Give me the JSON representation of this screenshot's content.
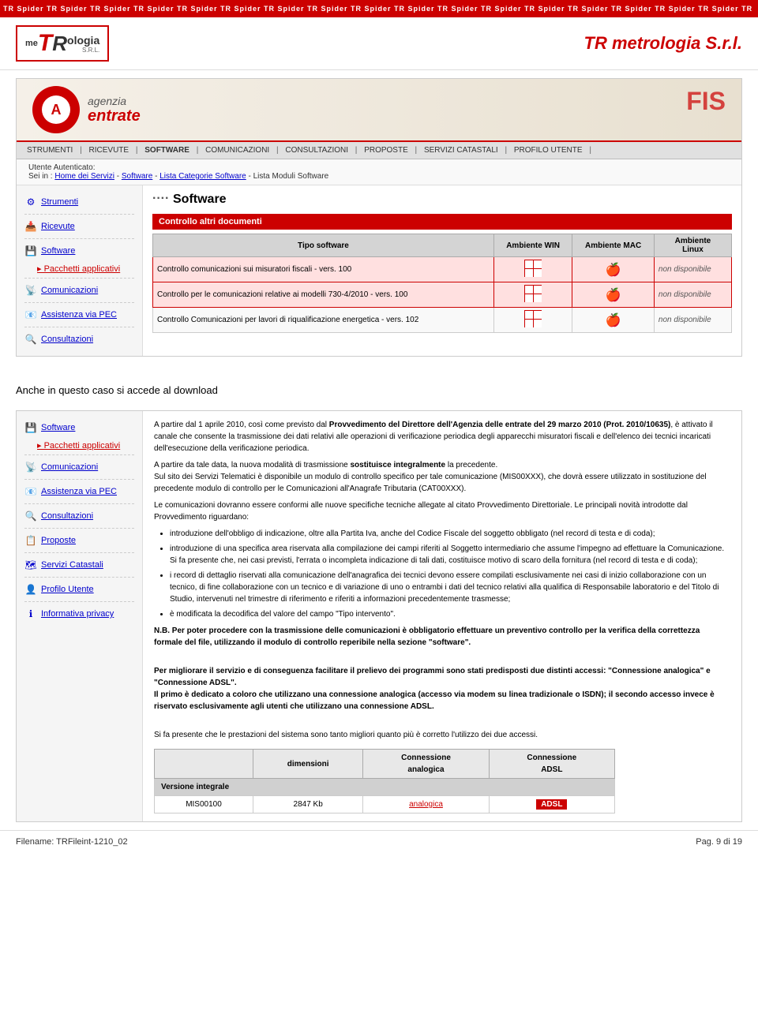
{
  "topBanner": {
    "text": "TR Spider  TR Spider  TR Spider  TR Spider  TR Spider  TR Spider  TR Spider  TR Spider  TR Spider  TR Spider  TR Spider  TR Spider  TR Spider  TR Spider  TR Spider  TR Spider  TR Spider  TR"
  },
  "header": {
    "logoPrefix": "me",
    "logoR": "R",
    "logoSuffix": "ologia",
    "logoSRL": "S.R.L.",
    "title": "TR metrologia S.r.l."
  },
  "agencyBanner": {
    "name1": "agenzia",
    "name2": "entrate",
    "rightText": "FIS"
  },
  "navBar": {
    "items": [
      "STRUMENTI",
      "RICEVUTE",
      "SOFTWARE",
      "COMUNICAZIONI",
      "CONSULTAZIONI",
      "PROPOSTE",
      "SERVIZI CATASTALI",
      "PROFILO UTENTE"
    ]
  },
  "breadcrumb": {
    "label": "Utente Autenticato:",
    "path": "Sei in : Home dei Servizi - Software - Lista Categorie Software - Lista Moduli Software"
  },
  "sidebar": {
    "items": [
      {
        "icon": "⚙",
        "label": "Strumenti"
      },
      {
        "icon": "📥",
        "label": "Ricevute"
      },
      {
        "icon": "💾",
        "label": "Software"
      },
      {
        "icon": "→",
        "label": "Pacchetti applicativi",
        "sub": true
      },
      {
        "icon": "📡",
        "label": "Comunicazioni"
      },
      {
        "icon": "📧",
        "label": "Assistenza via PEC"
      },
      {
        "icon": "🔍",
        "label": "Consultazioni"
      }
    ]
  },
  "mainPanel": {
    "title": "Software",
    "sectionHeader": "Controllo altri documenti",
    "tableHeaders": [
      "Tipo software",
      "Ambiente WIN",
      "Ambiente MAC",
      "Ambiente Linux"
    ],
    "tableRows": [
      {
        "tipo": "Controllo comunicazioni sui misuratori fiscali - vers. 100",
        "win": "win-icon",
        "mac": "mac-icon",
        "linux": "non disponibile",
        "highlighted": true
      },
      {
        "tipo": "Controllo per le comunicazioni relative ai modelli 730-4/2010 - vers. 100",
        "win": "win-icon",
        "mac": "mac-icon",
        "linux": "non disponibile",
        "highlighted": true
      },
      {
        "tipo": "Controllo Comunicazioni per lavori di riqualificazione energetica - vers. 102",
        "win": "win-icon",
        "mac": "mac-icon",
        "linux": "non disponibile",
        "highlighted": false
      }
    ]
  },
  "annotationText": "Anche in questo caso si accede al download",
  "bottomSidebar": {
    "items": [
      {
        "icon": "💾",
        "label": "Software"
      },
      {
        "icon": "→",
        "label": "Pacchetti applicativi",
        "sub": true
      },
      {
        "icon": "📡",
        "label": "Comunicazioni"
      },
      {
        "icon": "📧",
        "label": "Assistenza via PEC"
      },
      {
        "icon": "🔍",
        "label": "Consultazioni"
      },
      {
        "icon": "📋",
        "label": "Proposte"
      },
      {
        "icon": "🗺",
        "label": "Servizi Catastali"
      },
      {
        "icon": "👤",
        "label": "Profilo Utente"
      },
      {
        "icon": "ℹ",
        "label": "Informativa privacy"
      }
    ]
  },
  "bottomMain": {
    "paragraph1": "A partire dal 1 aprile 2010, così come previsto dal Provvedimento del Direttore dell'Agenzia delle entrate del 29 marzo 2010 (Prot. 2010/10635), è attivato il canale che consente la trasmissione dei dati relativi alle operazioni di verificazione periodica degli apparecchi misuratori fiscali e dell'elenco dei tecnici incaricati dell'esecuzione della verificazione periodica.",
    "paragraph2": "A partire da tale data, la nuova modalità di trasmissione sostituisce integralmente la precedente. Sul sito dei Servizi Telematici è disponibile un modulo di controllo specifico per tale comunicazione (MIS00XXX), che dovrà essere utilizzato in sostituzione del precedente modulo di controllo per le Comunicazioni all'Anagrafe Tributaria (CAT00XXX).",
    "paragraph3": "Le comunicazioni dovranno essere conformi alle nuove specifiche tecniche allegate al citato Provvedimento Direttoriale. Le principali novità introdotte dal Provvedimento riguardano:",
    "bullets": [
      "introduzione dell'obbligo di indicazione, oltre alla Partita Iva, anche del Codice Fiscale del soggetto obbligato (nel record di testa e di coda);",
      "introduzione di una specifica area riservata alla compilazione dei campi riferiti al Soggetto intermediario che assume l'impegno ad effettuare la Comunicazione. Si fa presente che, nei casi previsti, l'errata o incompleta indicazione di tali dati, costituisce motivo di scaro della fornitura (nel record di testa e di coda);",
      "i record di dettaglio riservati alla comunicazione dell'anagrafica dei tecnici devono essere compilati esclusivamente nei casi di inizio collaborazione con un tecnico, di fine collaborazione con un tecnico e di variazione di uno o entrambi i dati del tecnico relativi alla qualifica di Responsabile laboratorio e del Titolo di Studio, intervenuti nel trimestre di riferimento e riferiti a informazioni precedentemente trasmesse;",
      "è modificata la decodifica del valore del campo \"Tipo intervento\"."
    ],
    "note1": "N.B. Per poter procedere con la trasmissione delle comunicazioni è obbligatorio effettuare un preventivo controllo per la verifica della correttezza formale del file, utilizzando il modulo di controllo reperibile nella sezione \"software\".",
    "note2": "Per migliorare il servizio e di conseguenza facilitare il prelievo dei programmi sono stati predisposti due distinti accessi: \"Connessione analogica\" e \"Connessione ADSL\". Il primo è dedicato a coloro che utilizzano una connessione analogica (accesso via modem su linea tradizionale o ISDN); il secondo accesso invece è riservato esclusivamente agli utenti che utilizzano una connessione ADSL.",
    "note3": "Si fa presente che le prestazioni del sistema sono tanto migliori quanto più è corretto l'utilizzo dei due accessi.",
    "tableHeaders": [
      "dimensioni",
      "Connessione analogica",
      "Connessione ADSL"
    ],
    "tableRowLabel": "Versione integrale",
    "tableRow": {
      "name": "MIS00100",
      "size": "2847 Kb",
      "analogica": "analogica",
      "adsl": "ADSL"
    }
  },
  "footer": {
    "filename": "Filename: TRFileint-1210_02",
    "page": "Pag. 9 di 19"
  }
}
